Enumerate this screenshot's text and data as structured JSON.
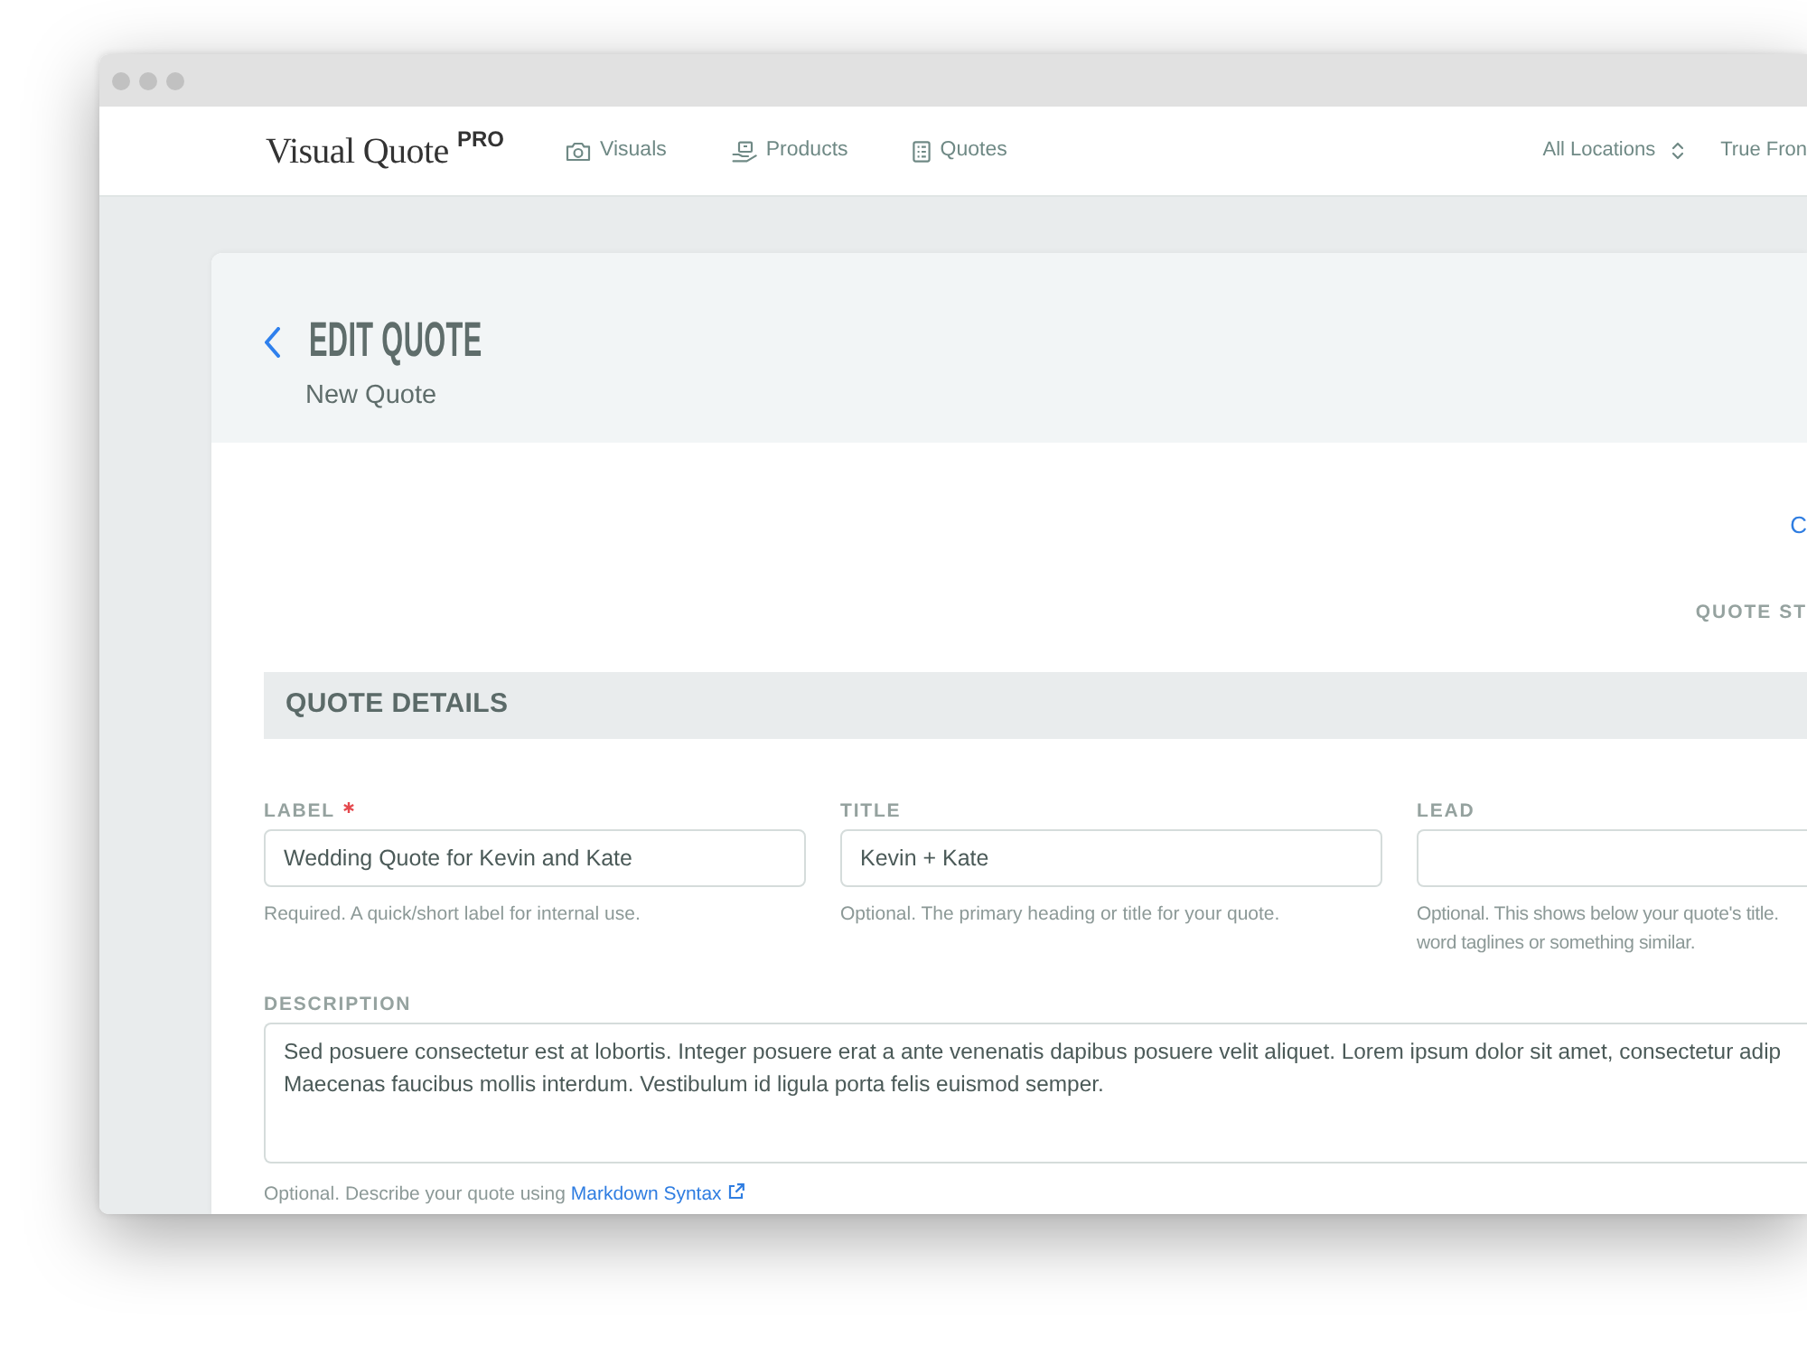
{
  "navbar": {
    "logo": {
      "text": "Visual Quote",
      "badge": "PRO"
    },
    "links": [
      {
        "label": "Visuals",
        "selected": false
      },
      {
        "label": "Products",
        "selected": false
      },
      {
        "label": "Quotes",
        "selected": false
      }
    ],
    "location_select": {
      "value": "All Locations"
    },
    "account": {
      "label": "True Fron"
    }
  },
  "page_header": {
    "title": "EDIT QUOTE",
    "subtitle": "New Quote"
  },
  "toolbar": {
    "link": "C",
    "status_label": "QUOTE ST"
  },
  "section": {
    "title": "QUOTE DETAILS",
    "fields": [
      {
        "label": "LABEL",
        "required": true,
        "value": "Wedding Quote for Kevin and Kate",
        "help": "Required. A quick/short label for internal use."
      },
      {
        "label": "TITLE",
        "required": false,
        "value": "Kevin + Kate",
        "help": "Optional. The primary heading or title for your quote."
      },
      {
        "label": "LEAD",
        "required": false,
        "help": "Optional. This shows below your quote's title. word taglines or something similar."
      }
    ],
    "description": {
      "label": "DESCRIPTION",
      "value": "Sed posuere consectetur est at lobortis. Integer posuere erat a ante venenatis dapibus posuere velit aliquet. Lorem ipsum dolor sit amet, consectetur adip\nMaecenas faucibus mollis interdum. Vestibulum id ligula porta felis euismod semper.",
      "help": "Optional. Describe your quote using",
      "help_link": "Markdown Syntax"
    }
  }
}
